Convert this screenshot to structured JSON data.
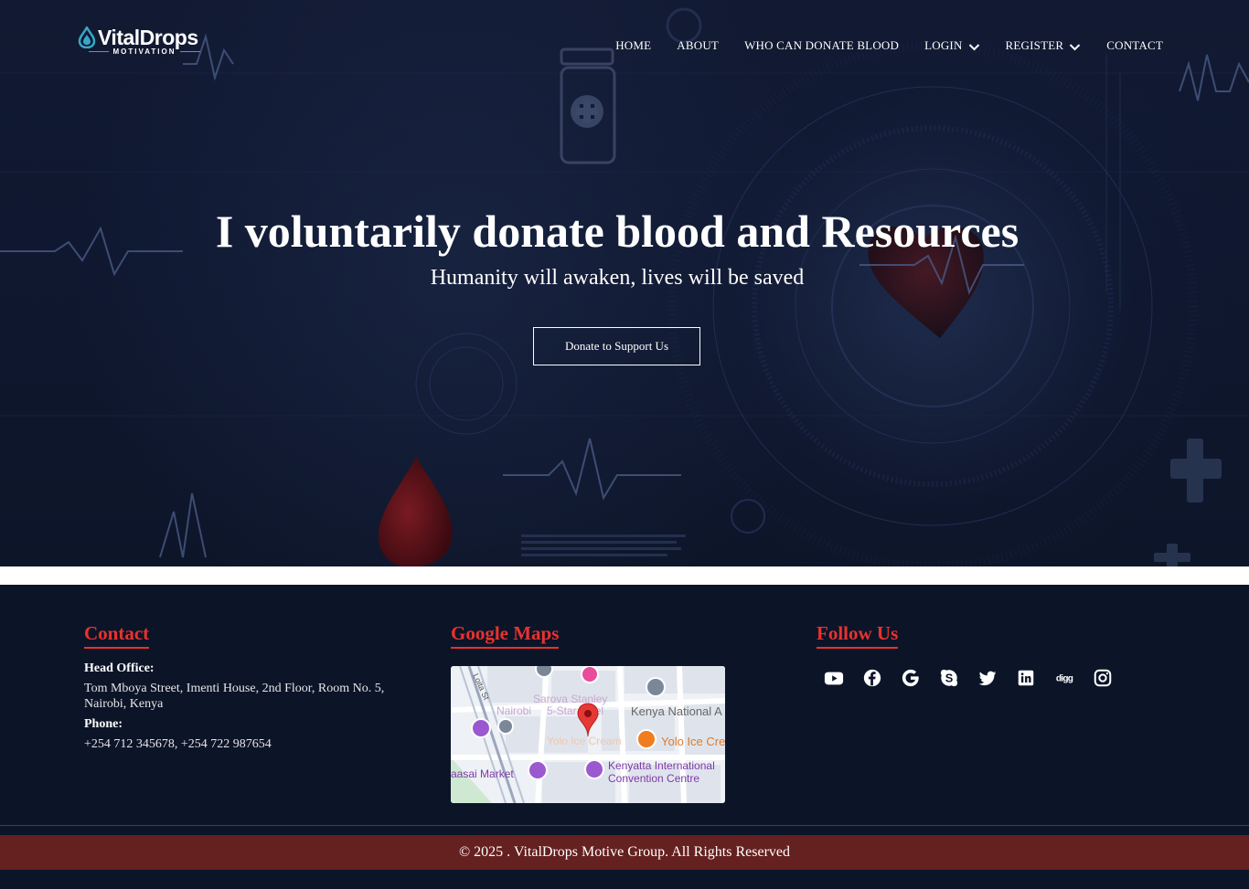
{
  "brand": {
    "name": "VitalDrops",
    "tagline": "MOTIVATION"
  },
  "nav": {
    "items": [
      {
        "label": "HOME",
        "dropdown": false
      },
      {
        "label": "ABOUT",
        "dropdown": false
      },
      {
        "label": "WHO CAN DONATE BLOOD",
        "dropdown": false
      },
      {
        "label": "LOGIN",
        "dropdown": true
      },
      {
        "label": "REGISTER",
        "dropdown": true
      },
      {
        "label": "CONTACT",
        "dropdown": false
      }
    ]
  },
  "hero": {
    "title": "I voluntarily donate blood and Resources",
    "subtitle": "Humanity will awaken, lives will be saved",
    "cta_label": "Donate to Support Us"
  },
  "footer": {
    "contact": {
      "title": "Contact",
      "head_office_label": "Head Office:",
      "address": "Tom Mboya Street, Imenti House, 2nd Floor, Room No. 5, Nairobi, Kenya",
      "phone_label": "Phone:",
      "phone": "+254 712 345678, +254 722 987654"
    },
    "maps": {
      "title": "Google Maps",
      "labels": {
        "hotel": "Sarova Stanley",
        "nairobi": "Nairobi",
        "star": "5-Star hotel",
        "museum": "Kenya National A",
        "yolo_faint": "Yolo Ice Cream",
        "yolo": "Yolo Ice Cre",
        "market": "aasai Market",
        "kicc_1": "Kenyatta International",
        "kicc_2": "Convention Centre",
        "street": "Loita St"
      }
    },
    "follow": {
      "title": "Follow Us",
      "icons": [
        "youtube-icon",
        "facebook-icon",
        "google-icon",
        "skype-icon",
        "twitter-icon",
        "linkedin-icon",
        "digg-icon",
        "instagram-icon"
      ]
    },
    "copyright": "© 2025 . VitalDrops Motive Group. All Rights Reserved"
  },
  "colors": {
    "accent_red": "#e8322e",
    "copyright_bar": "#652020",
    "background": "#0c1428",
    "brand_teal": "#36a8c7"
  }
}
